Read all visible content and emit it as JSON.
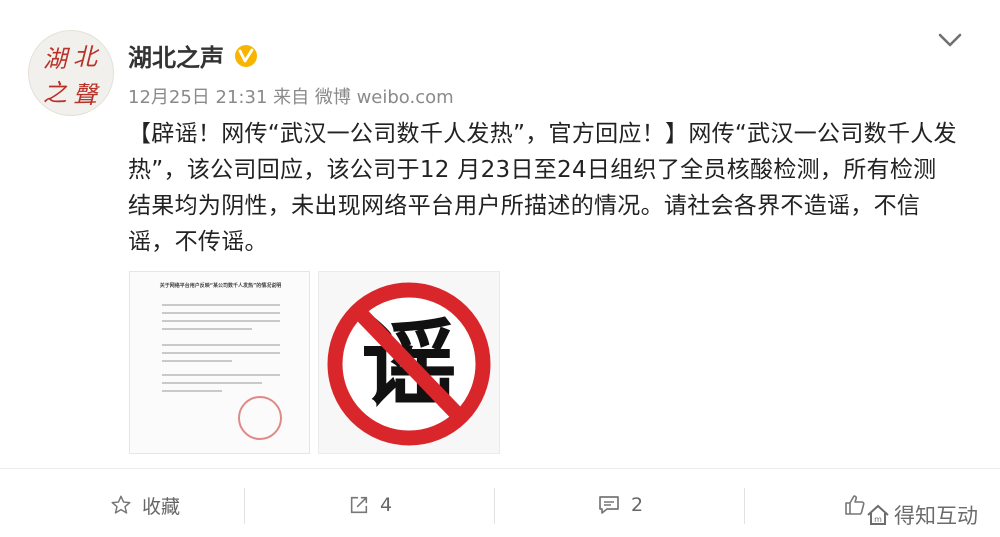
{
  "account": {
    "name": "湖北之声",
    "avatar_glyphs": [
      "湖",
      "北",
      "之",
      "聲"
    ]
  },
  "meta": {
    "date": "12月25日 21:31",
    "source": "来自 微博 weibo.com"
  },
  "content": {
    "text": "【辟谣！网传“武汉一公司数千人发热”，官方回应！】网传“武汉一公司数千人发热”，该公司回应，该公司于12 月23日至24日组织了全员核酸检测，所有检测结果均为阴性，未出现网络平台用户所描述的情况。请社会各界不造谣，不信谣，不传谣。"
  },
  "images": {
    "doc_title": "关于网络平台用户反映“某公司数千人发热”的情况说明",
    "rumor_glyph": "谣"
  },
  "actions": {
    "favorite_label": "收藏",
    "repost_count": "4",
    "comment_count": "2"
  },
  "watermark": {
    "text": "得知互动"
  },
  "colors": {
    "verified": "#f7b500",
    "prohibition_red": "#d9262b"
  }
}
